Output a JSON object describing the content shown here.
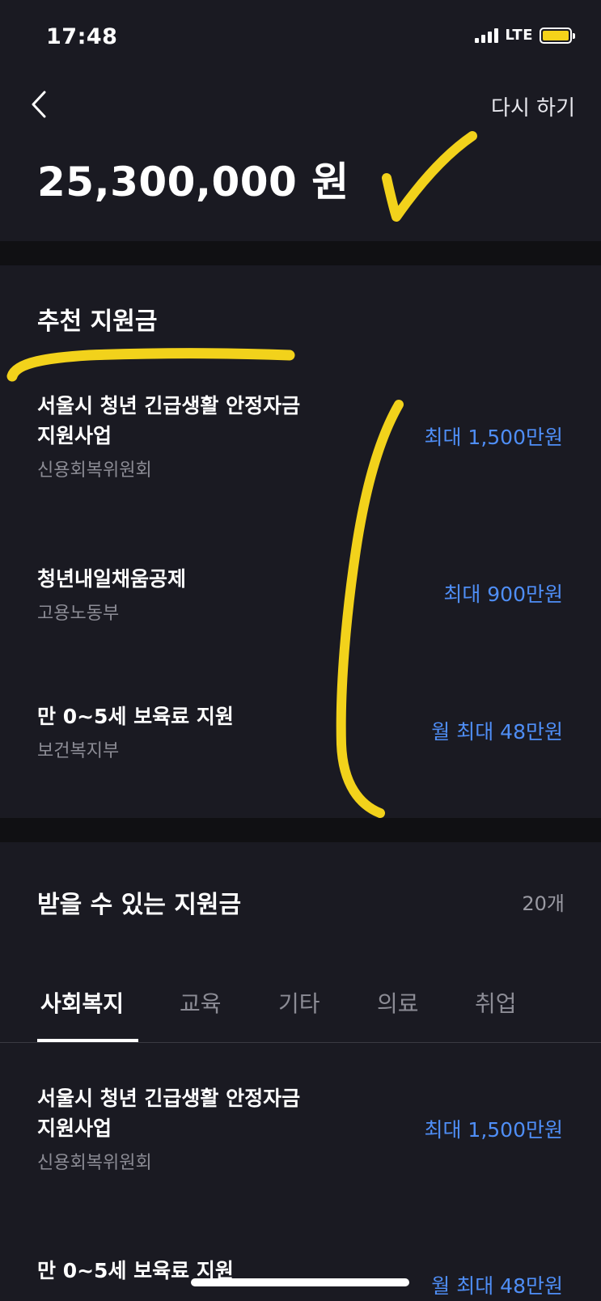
{
  "status_bar": {
    "time": "17:48",
    "network": "LTE"
  },
  "header": {
    "back_icon": "chevron-left-icon",
    "retry_label": "다시 하기"
  },
  "total_amount": "25,300,000 원",
  "recommended": {
    "title": "추천 지원금",
    "items": [
      {
        "title_line1": "서울시 청년 긴급생활 안정자금",
        "title_line2": "지원사업",
        "org": "신용회복위원회",
        "amount": "최대 1,500만원"
      },
      {
        "title_line1": "청년내일채움공제",
        "title_line2": "",
        "org": "고용노동부",
        "amount": "최대 900만원"
      },
      {
        "title_line1": "만 0~5세 보육료 지원",
        "title_line2": "",
        "org": "보건복지부",
        "amount": "월 최대 48만원"
      }
    ]
  },
  "available": {
    "title": "받을 수 있는 지원금",
    "count": "20개",
    "tabs": [
      "사회복지",
      "교육",
      "기타",
      "의료",
      "취업"
    ],
    "active_tab": "사회복지",
    "items": [
      {
        "title_line1": "서울시 청년 긴급생활 안정자금",
        "title_line2": "지원사업",
        "org": "신용회복위원회",
        "amount": "최대 1,500만원"
      },
      {
        "title_line1": "만 0~5세 보육료 지원",
        "title_line2": "",
        "org": "",
        "amount": "월 최대 48만원"
      }
    ]
  },
  "colors": {
    "background": "#1a1a22",
    "separator": "#101013",
    "accent": "#4f8ef6",
    "annotation": "#f2d21b",
    "battery": "#f5d31a"
  }
}
